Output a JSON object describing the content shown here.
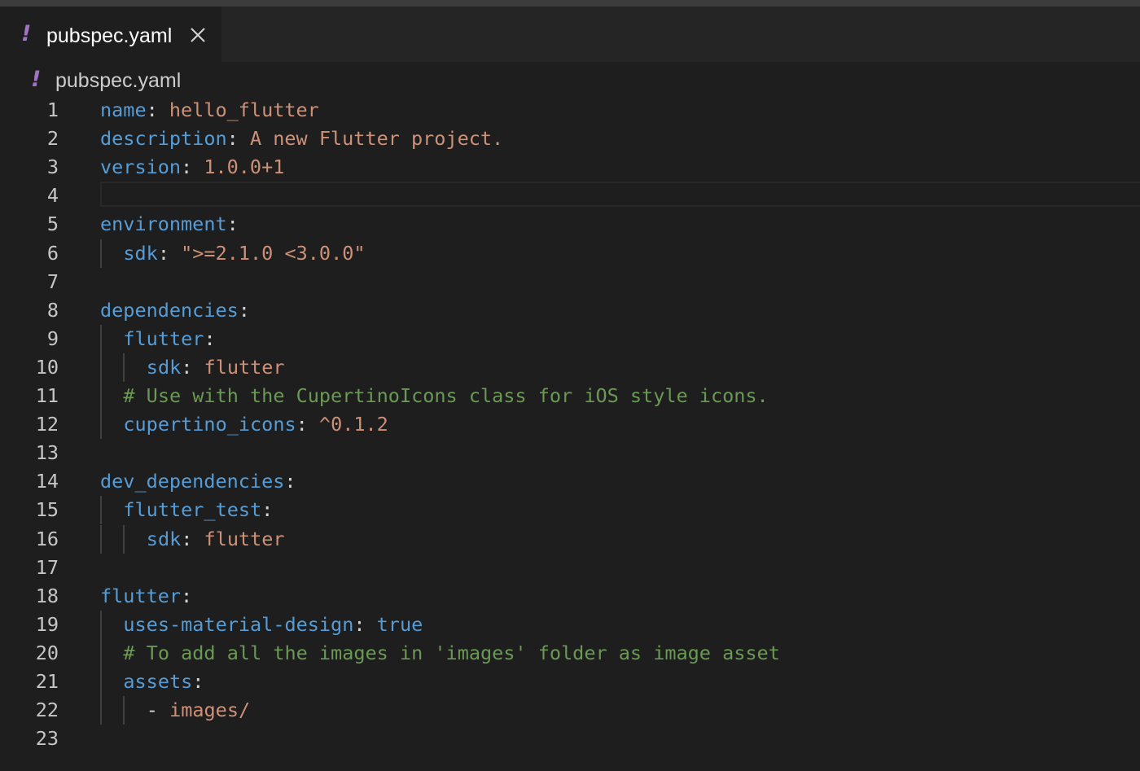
{
  "tab": {
    "icon": "!",
    "label": "pubspec.yaml",
    "close_icon": "close-icon"
  },
  "breadcrumb": {
    "icon": "!",
    "label": "pubspec.yaml"
  },
  "colors": {
    "key": "#569cd6",
    "string": "#ce9178",
    "comment": "#6a9955",
    "yaml_icon": "#a074c4"
  },
  "lines": [
    {
      "n": "1",
      "indent": 0,
      "tokens": [
        {
          "t": "name",
          "c": "key"
        },
        {
          "t": ": ",
          "c": "punc"
        },
        {
          "t": "hello_flutter",
          "c": "str"
        }
      ]
    },
    {
      "n": "2",
      "indent": 0,
      "tokens": [
        {
          "t": "description",
          "c": "key"
        },
        {
          "t": ": ",
          "c": "punc"
        },
        {
          "t": "A new Flutter project.",
          "c": "str"
        }
      ]
    },
    {
      "n": "3",
      "indent": 0,
      "tokens": [
        {
          "t": "version",
          "c": "key"
        },
        {
          "t": ": ",
          "c": "punc"
        },
        {
          "t": "1.0.0+1",
          "c": "str"
        }
      ]
    },
    {
      "n": "4",
      "indent": 0,
      "current": true,
      "tokens": []
    },
    {
      "n": "5",
      "indent": 0,
      "tokens": [
        {
          "t": "environment",
          "c": "key"
        },
        {
          "t": ":",
          "c": "punc"
        }
      ]
    },
    {
      "n": "6",
      "indent": 1,
      "tokens": [
        {
          "t": "sdk",
          "c": "key"
        },
        {
          "t": ": ",
          "c": "punc"
        },
        {
          "t": "\">=2.1.0 <3.0.0\"",
          "c": "str"
        }
      ]
    },
    {
      "n": "7",
      "indent": 0,
      "tokens": []
    },
    {
      "n": "8",
      "indent": 0,
      "tokens": [
        {
          "t": "dependencies",
          "c": "key"
        },
        {
          "t": ":",
          "c": "punc"
        }
      ]
    },
    {
      "n": "9",
      "indent": 1,
      "tokens": [
        {
          "t": "flutter",
          "c": "key"
        },
        {
          "t": ":",
          "c": "punc"
        }
      ]
    },
    {
      "n": "10",
      "indent": 2,
      "tokens": [
        {
          "t": "sdk",
          "c": "key"
        },
        {
          "t": ": ",
          "c": "punc"
        },
        {
          "t": "flutter",
          "c": "str"
        }
      ]
    },
    {
      "n": "11",
      "indent": 1,
      "tokens": [
        {
          "t": "# Use with the CupertinoIcons class for iOS style icons.",
          "c": "com"
        }
      ]
    },
    {
      "n": "12",
      "indent": 1,
      "tokens": [
        {
          "t": "cupertino_icons",
          "c": "key"
        },
        {
          "t": ": ",
          "c": "punc"
        },
        {
          "t": "^0.1.2",
          "c": "str"
        }
      ]
    },
    {
      "n": "13",
      "indent": 0,
      "tokens": []
    },
    {
      "n": "14",
      "indent": 0,
      "tokens": [
        {
          "t": "dev_dependencies",
          "c": "key"
        },
        {
          "t": ":",
          "c": "punc"
        }
      ]
    },
    {
      "n": "15",
      "indent": 1,
      "tokens": [
        {
          "t": "flutter_test",
          "c": "key"
        },
        {
          "t": ":",
          "c": "punc"
        }
      ]
    },
    {
      "n": "16",
      "indent": 2,
      "tokens": [
        {
          "t": "sdk",
          "c": "key"
        },
        {
          "t": ": ",
          "c": "punc"
        },
        {
          "t": "flutter",
          "c": "str"
        }
      ]
    },
    {
      "n": "17",
      "indent": 0,
      "tokens": []
    },
    {
      "n": "18",
      "indent": 0,
      "tokens": [
        {
          "t": "flutter",
          "c": "key"
        },
        {
          "t": ":",
          "c": "punc"
        }
      ]
    },
    {
      "n": "19",
      "indent": 1,
      "tokens": [
        {
          "t": "uses-material-design",
          "c": "key"
        },
        {
          "t": ": ",
          "c": "punc"
        },
        {
          "t": "true",
          "c": "bool"
        }
      ]
    },
    {
      "n": "20",
      "indent": 1,
      "tokens": [
        {
          "t": "# To add all the images in 'images' folder as image asset",
          "c": "com"
        }
      ]
    },
    {
      "n": "21",
      "indent": 1,
      "tokens": [
        {
          "t": "assets",
          "c": "key"
        },
        {
          "t": ":",
          "c": "punc"
        }
      ]
    },
    {
      "n": "22",
      "indent": 2,
      "tokens": [
        {
          "t": "- ",
          "c": "punc"
        },
        {
          "t": "images/",
          "c": "str"
        }
      ]
    },
    {
      "n": "23",
      "indent": 0,
      "tokens": []
    }
  ]
}
